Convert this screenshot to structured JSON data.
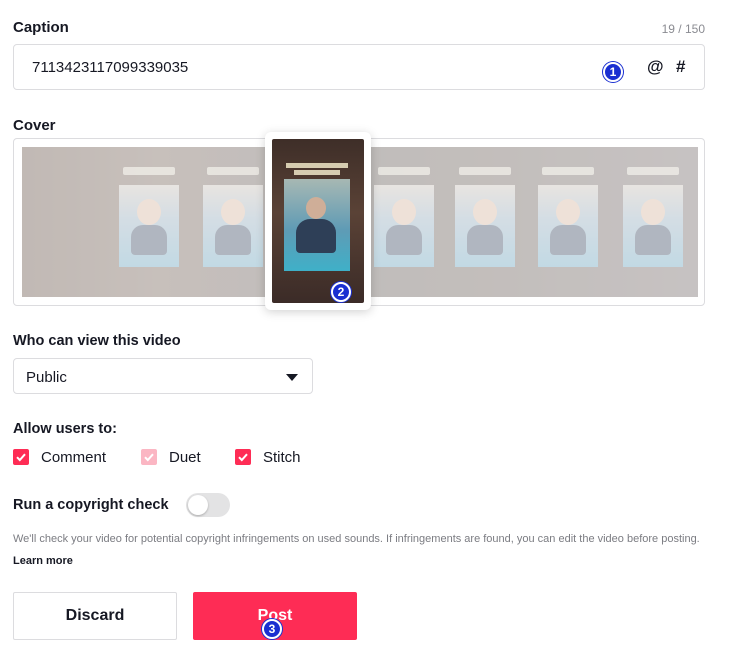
{
  "caption": {
    "label": "Caption",
    "counter": "19 / 150",
    "value": "7113423117099339035",
    "mention_symbol": "@",
    "hashtag_symbol": "#"
  },
  "cover": {
    "label": "Cover"
  },
  "visibility": {
    "label": "Who can view this video",
    "selected": "Public"
  },
  "permissions": {
    "label": "Allow users to:",
    "options": [
      {
        "label": "Comment",
        "checked": true
      },
      {
        "label": "Duet",
        "checked": true
      },
      {
        "label": "Stitch",
        "checked": true
      }
    ]
  },
  "copyright": {
    "label": "Run a copyright check",
    "enabled": false,
    "description": "We'll check your video for potential copyright infringements on used sounds. If infringements are found, you can edit the video before posting.",
    "learn_more": "Learn more"
  },
  "actions": {
    "discard": "Discard",
    "post": "Post"
  },
  "markers": [
    "1",
    "2",
    "3"
  ],
  "colors": {
    "accent": "#fe2c55",
    "accent_light": "#fbb6c3",
    "marker": "#1a2fd1",
    "border": "#dcdcdf"
  },
  "icons": [
    "check-icon",
    "caret-down-icon"
  ]
}
